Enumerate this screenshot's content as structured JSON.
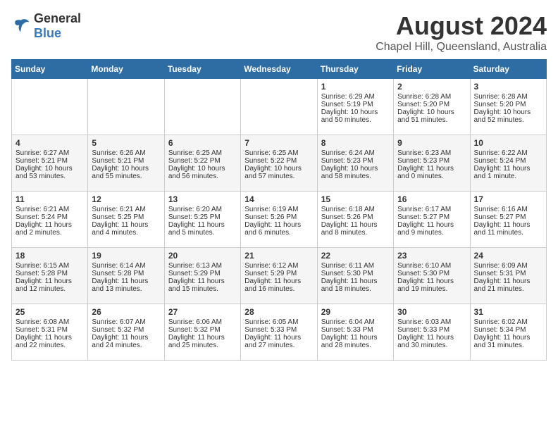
{
  "header": {
    "logo_general": "General",
    "logo_blue": "Blue",
    "title": "August 2024",
    "subtitle": "Chapel Hill, Queensland, Australia"
  },
  "weekdays": [
    "Sunday",
    "Monday",
    "Tuesday",
    "Wednesday",
    "Thursday",
    "Friday",
    "Saturday"
  ],
  "weeks": [
    [
      {
        "day": "",
        "info": ""
      },
      {
        "day": "",
        "info": ""
      },
      {
        "day": "",
        "info": ""
      },
      {
        "day": "",
        "info": ""
      },
      {
        "day": "1",
        "info": "Sunrise: 6:29 AM\nSunset: 5:19 PM\nDaylight: 10 hours and 50 minutes."
      },
      {
        "day": "2",
        "info": "Sunrise: 6:28 AM\nSunset: 5:20 PM\nDaylight: 10 hours and 51 minutes."
      },
      {
        "day": "3",
        "info": "Sunrise: 6:28 AM\nSunset: 5:20 PM\nDaylight: 10 hours and 52 minutes."
      }
    ],
    [
      {
        "day": "4",
        "info": "Sunrise: 6:27 AM\nSunset: 5:21 PM\nDaylight: 10 hours and 53 minutes."
      },
      {
        "day": "5",
        "info": "Sunrise: 6:26 AM\nSunset: 5:21 PM\nDaylight: 10 hours and 55 minutes."
      },
      {
        "day": "6",
        "info": "Sunrise: 6:25 AM\nSunset: 5:22 PM\nDaylight: 10 hours and 56 minutes."
      },
      {
        "day": "7",
        "info": "Sunrise: 6:25 AM\nSunset: 5:22 PM\nDaylight: 10 hours and 57 minutes."
      },
      {
        "day": "8",
        "info": "Sunrise: 6:24 AM\nSunset: 5:23 PM\nDaylight: 10 hours and 58 minutes."
      },
      {
        "day": "9",
        "info": "Sunrise: 6:23 AM\nSunset: 5:23 PM\nDaylight: 11 hours and 0 minutes."
      },
      {
        "day": "10",
        "info": "Sunrise: 6:22 AM\nSunset: 5:24 PM\nDaylight: 11 hours and 1 minute."
      }
    ],
    [
      {
        "day": "11",
        "info": "Sunrise: 6:21 AM\nSunset: 5:24 PM\nDaylight: 11 hours and 2 minutes."
      },
      {
        "day": "12",
        "info": "Sunrise: 6:21 AM\nSunset: 5:25 PM\nDaylight: 11 hours and 4 minutes."
      },
      {
        "day": "13",
        "info": "Sunrise: 6:20 AM\nSunset: 5:25 PM\nDaylight: 11 hours and 5 minutes."
      },
      {
        "day": "14",
        "info": "Sunrise: 6:19 AM\nSunset: 5:26 PM\nDaylight: 11 hours and 6 minutes."
      },
      {
        "day": "15",
        "info": "Sunrise: 6:18 AM\nSunset: 5:26 PM\nDaylight: 11 hours and 8 minutes."
      },
      {
        "day": "16",
        "info": "Sunrise: 6:17 AM\nSunset: 5:27 PM\nDaylight: 11 hours and 9 minutes."
      },
      {
        "day": "17",
        "info": "Sunrise: 6:16 AM\nSunset: 5:27 PM\nDaylight: 11 hours and 11 minutes."
      }
    ],
    [
      {
        "day": "18",
        "info": "Sunrise: 6:15 AM\nSunset: 5:28 PM\nDaylight: 11 hours and 12 minutes."
      },
      {
        "day": "19",
        "info": "Sunrise: 6:14 AM\nSunset: 5:28 PM\nDaylight: 11 hours and 13 minutes."
      },
      {
        "day": "20",
        "info": "Sunrise: 6:13 AM\nSunset: 5:29 PM\nDaylight: 11 hours and 15 minutes."
      },
      {
        "day": "21",
        "info": "Sunrise: 6:12 AM\nSunset: 5:29 PM\nDaylight: 11 hours and 16 minutes."
      },
      {
        "day": "22",
        "info": "Sunrise: 6:11 AM\nSunset: 5:30 PM\nDaylight: 11 hours and 18 minutes."
      },
      {
        "day": "23",
        "info": "Sunrise: 6:10 AM\nSunset: 5:30 PM\nDaylight: 11 hours and 19 minutes."
      },
      {
        "day": "24",
        "info": "Sunrise: 6:09 AM\nSunset: 5:31 PM\nDaylight: 11 hours and 21 minutes."
      }
    ],
    [
      {
        "day": "25",
        "info": "Sunrise: 6:08 AM\nSunset: 5:31 PM\nDaylight: 11 hours and 22 minutes."
      },
      {
        "day": "26",
        "info": "Sunrise: 6:07 AM\nSunset: 5:32 PM\nDaylight: 11 hours and 24 minutes."
      },
      {
        "day": "27",
        "info": "Sunrise: 6:06 AM\nSunset: 5:32 PM\nDaylight: 11 hours and 25 minutes."
      },
      {
        "day": "28",
        "info": "Sunrise: 6:05 AM\nSunset: 5:33 PM\nDaylight: 11 hours and 27 minutes."
      },
      {
        "day": "29",
        "info": "Sunrise: 6:04 AM\nSunset: 5:33 PM\nDaylight: 11 hours and 28 minutes."
      },
      {
        "day": "30",
        "info": "Sunrise: 6:03 AM\nSunset: 5:33 PM\nDaylight: 11 hours and 30 minutes."
      },
      {
        "day": "31",
        "info": "Sunrise: 6:02 AM\nSunset: 5:34 PM\nDaylight: 11 hours and 31 minutes."
      }
    ]
  ]
}
